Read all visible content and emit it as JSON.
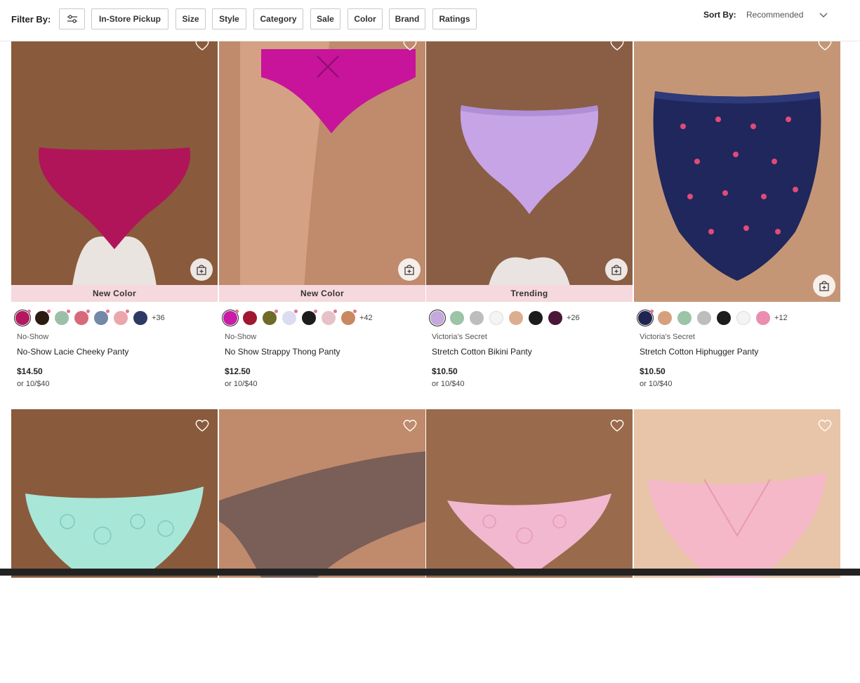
{
  "filter": {
    "label": "Filter By:",
    "chips": [
      "In-Store Pickup",
      "Size",
      "Style",
      "Category",
      "Sale",
      "Color",
      "Brand",
      "Ratings"
    ]
  },
  "sort": {
    "label": "Sort By:",
    "value": "Recommended"
  },
  "products": [
    {
      "badge": "New Color",
      "more": "+36",
      "brand": "No-Show",
      "name": "No-Show Lacie Cheeky Panty",
      "price": "$14.50",
      "deal": "or 10/$40",
      "swatches": [
        "#b5175f",
        "#2a1a12",
        "#9cbfa8",
        "#d8697a",
        "#7488a8",
        "#eaa6aa",
        "#2d3a64"
      ],
      "skin": "#8a5a3c",
      "garment": "#b0155a",
      "bg": "#e9e4df"
    },
    {
      "badge": "New Color",
      "more": "+42",
      "brand": "No-Show",
      "name": "No Show Strappy Thong Panty",
      "price": "$12.50",
      "deal": "or 10/$40",
      "swatches": [
        "#c91aa8",
        "#a01830",
        "#6e6a28",
        "#dcdcf0",
        "#1c1c1c",
        "#e6c2c8",
        "#c98860"
      ],
      "skin": "#c08a6c",
      "garment": "#c7149a",
      "bg": "#e8e2dd"
    },
    {
      "badge": "Trending",
      "more": "+26",
      "brand": "Victoria's Secret",
      "name": "Stretch Cotton Bikini Panty",
      "price": "$10.50",
      "deal": "or 10/$40",
      "swatches": [
        "#c5a8dc",
        "#9cc4a6",
        "#bdbdbd",
        "#f4f4f4",
        "#dcae90",
        "#1c1c1c",
        "#4a1638"
      ],
      "skin": "#8a5e44",
      "garment": "#c7a4e6",
      "bg": "#e9e4e1"
    },
    {
      "badge": "",
      "more": "+12",
      "brand": "Victoria's Secret",
      "name": "Stretch Cotton Hiphugger Panty",
      "price": "$10.50",
      "deal": "or 10/$40",
      "swatches": [
        "#1f2550",
        "#d7a07c",
        "#9cc4a6",
        "#bdbdbd",
        "#1c1c1c",
        "#f4f4f4",
        "#ea8db0"
      ],
      "skin": "#c59676",
      "garment": "#1f275c",
      "bg": "#ebe6e2"
    },
    {
      "skin": "#8a5a3c",
      "garment": "#a8e6d8",
      "bg": "#e9e4df"
    },
    {
      "skin": "#c08a6c",
      "garment": "#7a5e58",
      "bg": "#e8e2dd"
    },
    {
      "skin": "#9a6a4c",
      "garment": "#f2b8cf",
      "bg": "#e9e4e1"
    },
    {
      "skin": "#e8c4a8",
      "garment": "#f5b8c8",
      "bg": "#ebe6e2"
    }
  ],
  "icons": {
    "filter": "sliders-icon",
    "sort": "chevron-down-icon",
    "wishlist": "heart-icon",
    "quickadd": "shopping-bag-plus-icon"
  }
}
